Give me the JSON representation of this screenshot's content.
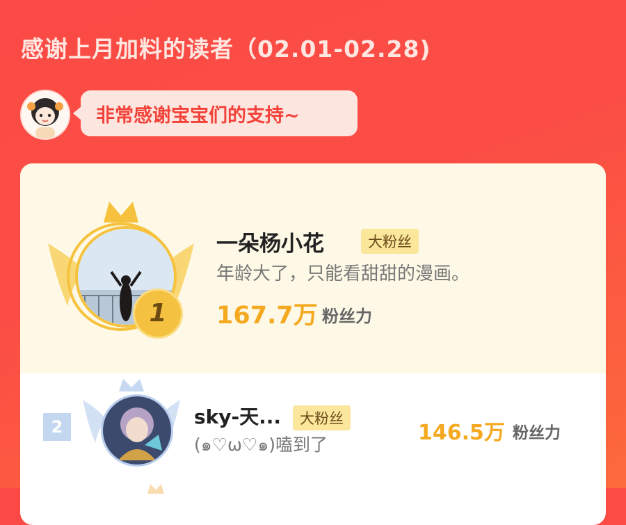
{
  "header": {
    "title": "感谢上月加料的读者（02.01-02.28)"
  },
  "author": {
    "avatar_icon": "cartoon-girl-avatar-icon",
    "message": "非常感谢宝宝们的支持~"
  },
  "ranking": [
    {
      "rank": "1",
      "name": "一朵杨小花",
      "tag": "大粉丝",
      "message": "年龄大了，只能看甜甜的漫画。",
      "score": "167.7万",
      "unit": "粉丝力",
      "avatar_icon": "photo-avatar-icon",
      "badge_color": "#f5c141"
    },
    {
      "rank": "2",
      "name": "sky-天...",
      "tag": "大粉丝",
      "message": "(๑♡ω♡๑)嗑到了",
      "score": "146.5万",
      "unit": "粉丝力",
      "avatar_icon": "anime-character-avatar-icon",
      "badge_color": "#c3d7f0"
    }
  ],
  "colors": {
    "background": "#fb4d45",
    "accent": "#f5a921",
    "first_block": "#fdf9e6"
  }
}
